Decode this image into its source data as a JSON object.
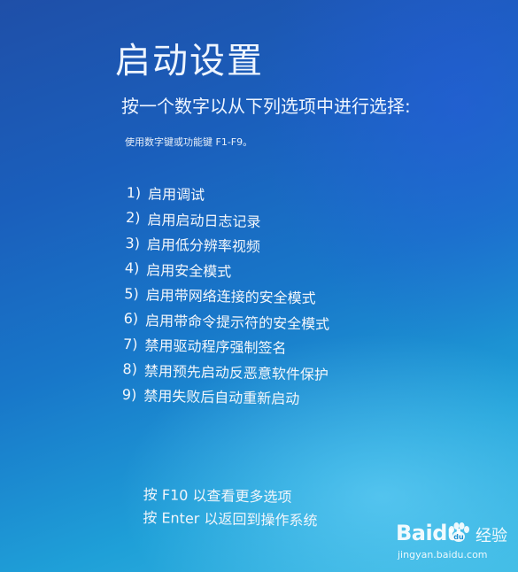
{
  "screen": {
    "title": "启动设置",
    "subtitle": "按一个数字以从下列选项中进行选择:",
    "hint": "使用数字键或功能键 F1-F9。"
  },
  "options": [
    {
      "number": "1)",
      "label": "启用调试"
    },
    {
      "number": "2)",
      "label": "启用启动日志记录"
    },
    {
      "number": "3)",
      "label": "启用低分辨率视频"
    },
    {
      "number": "4)",
      "label": "启用安全模式"
    },
    {
      "number": "5)",
      "label": "启用带网络连接的安全模式"
    },
    {
      "number": "6)",
      "label": "启用带命令提示符的安全模式"
    },
    {
      "number": "7)",
      "label": "禁用驱动程序强制签名"
    },
    {
      "number": "8)",
      "label": "禁用预先启动反恶意软件保护"
    },
    {
      "number": "9)",
      "label": "禁用失败后自动重新启动"
    }
  ],
  "footer": {
    "more_options": "按 F10 以查看更多选项",
    "return": "按 Enter 以返回到操作系统"
  },
  "watermark": {
    "logo_text": "Baidu",
    "logo_suffix": "经验",
    "url": "jingyan.baidu.com",
    "icon": "paw-icon"
  },
  "colors": {
    "background_top": "#1f4fa8",
    "background_bottom": "#39b8e2",
    "text": "#eef5ff"
  }
}
